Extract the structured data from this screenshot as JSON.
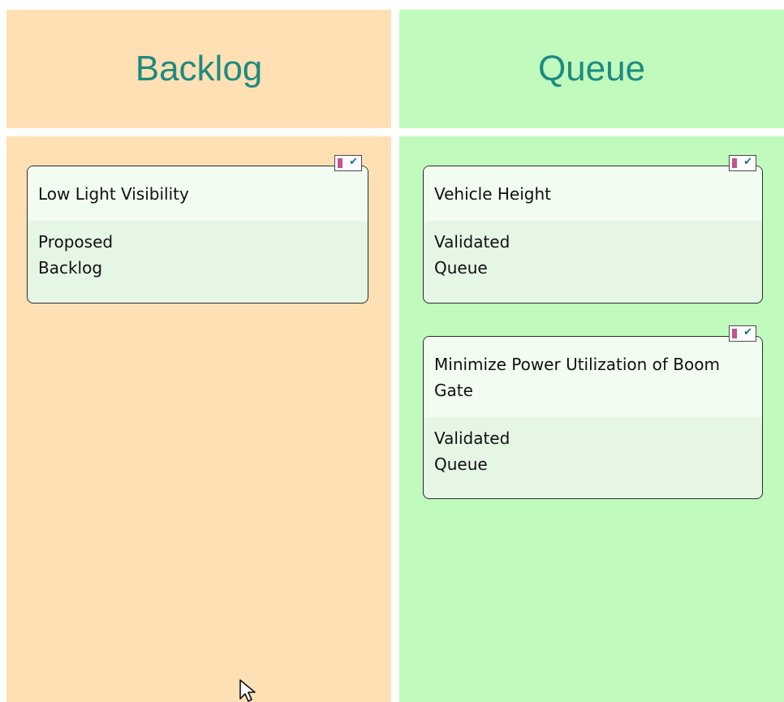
{
  "columns": [
    {
      "title": "Backlog",
      "color": "#ffe0b5",
      "cards": [
        {
          "title": "Low Light Visibility",
          "status": "Proposed",
          "phase": "Backlog",
          "icon": "requirement-check-icon"
        }
      ]
    },
    {
      "title": "Queue",
      "color": "#c0fbbd",
      "cards": [
        {
          "title": "Vehicle Height",
          "status": "Validated",
          "phase": "Queue",
          "icon": "requirement-check-icon"
        },
        {
          "title": "Minimize Power Utilization of Boom Gate",
          "status": "Validated",
          "phase": "Queue",
          "icon": "requirement-check-icon"
        }
      ]
    }
  ],
  "header_text_color": "#1f8a80",
  "check_glyph": "✔",
  "cursor_icon": "mouse-pointer-icon"
}
